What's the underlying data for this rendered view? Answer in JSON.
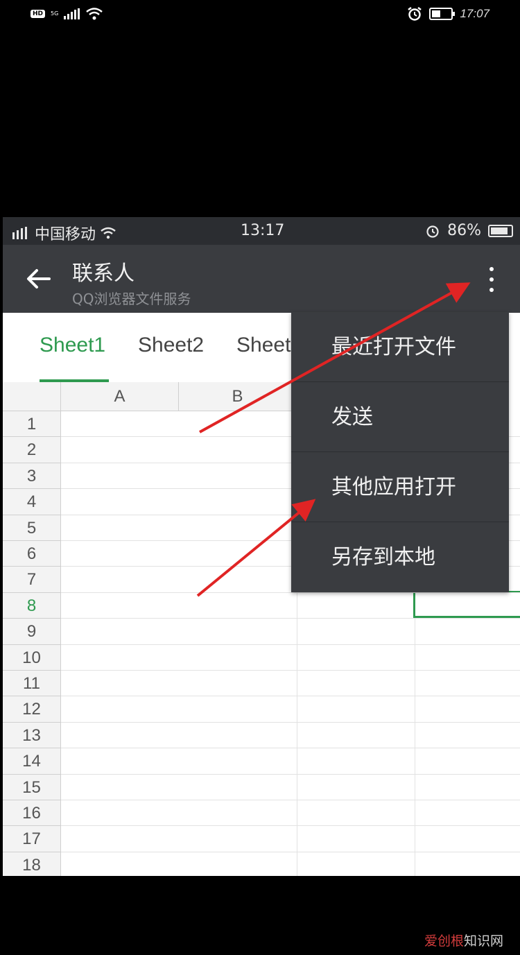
{
  "outer_status": {
    "hd": "HD",
    "network": "5G",
    "time": "17:07",
    "icons": [
      "signal-icon",
      "wifi-icon",
      "alarm-icon",
      "battery-icon"
    ]
  },
  "inner_status": {
    "carrier": "中国移动",
    "time": "13:17",
    "battery": "86%",
    "battery_level": 0.86
  },
  "appbar": {
    "title": "联系人",
    "subtitle": "QQ浏览器文件服务"
  },
  "tabs": [
    {
      "label": "Sheet1",
      "active": true
    },
    {
      "label": "Sheet2",
      "active": false
    },
    {
      "label": "Sheet",
      "active": false
    }
  ],
  "grid": {
    "columns": [
      "A",
      "B"
    ],
    "rows": [
      "1",
      "2",
      "3",
      "4",
      "5",
      "6",
      "7",
      "8",
      "9",
      "10",
      "11",
      "12",
      "13",
      "14",
      "15",
      "16",
      "17",
      "18"
    ],
    "active_row": "8"
  },
  "menu": {
    "items": [
      "最近打开文件",
      "发送",
      "其他应用打开",
      "另存到本地"
    ]
  },
  "watermark": {
    "accent": "爱创根",
    "rest": "知识网"
  },
  "colors": {
    "accent_green": "#2e9a4f",
    "appbar": "#3a3c40",
    "arrow_red": "#e02424"
  }
}
